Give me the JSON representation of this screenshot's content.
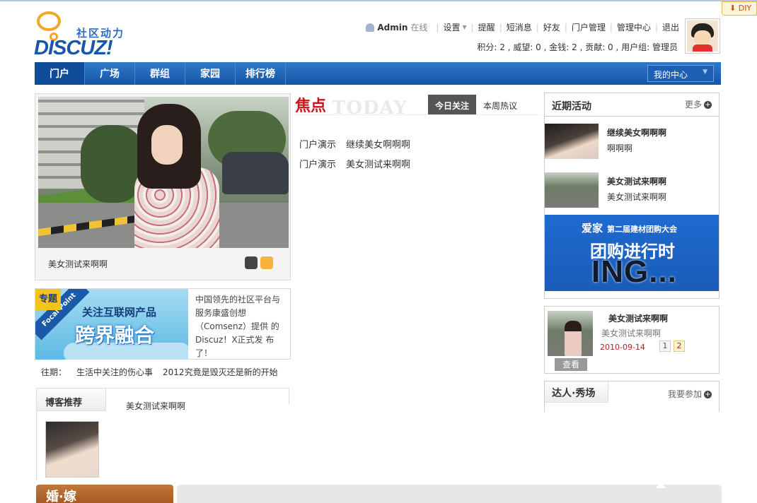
{
  "diy": {
    "label": "DIY"
  },
  "logo": {
    "slogan": "社区动力",
    "word": "DISCUZ!"
  },
  "user": {
    "name": "Admin",
    "status": "在线",
    "links": [
      "设置",
      "提醒",
      "短消息",
      "好友",
      "门户管理",
      "管理中心",
      "退出"
    ]
  },
  "credits": {
    "text": "积分: 2 , 威望: 0 , 金钱: 2 , 贡献: 0 , 用户组: 管理员"
  },
  "nav": {
    "items": [
      "门户",
      "广场",
      "群组",
      "家园",
      "排行榜"
    ],
    "my_center": "我的中心"
  },
  "slide": {
    "caption": "美女测试来啊啊"
  },
  "topic": {
    "tag": "专题",
    "ribbon": "Focal Point",
    "title_small": "关注互联网产品",
    "title_big": "跨界融合",
    "description": "中国领先的社区平台与服务康盛创想（Comsenz）提供 的Discuz！X正式发 布了！"
  },
  "past": {
    "label": "往期：",
    "items": [
      "生活中关注的伤心事",
      "2012究竟是毁灭还是新的开始"
    ]
  },
  "blog": {
    "title": "博客推荐",
    "text": "美女测试来啊啊"
  },
  "hunlian": {
    "title": "婚·嫁"
  },
  "focus": {
    "title": "焦点",
    "watermark": "TODAY",
    "tabs": [
      "今日关注",
      "本周热议"
    ],
    "items": [
      {
        "category": "门户演示",
        "title": "继续美女啊啊啊"
      },
      {
        "category": "门户演示",
        "title": "美女测试来啊啊"
      }
    ]
  },
  "activity": {
    "title": "近期活动",
    "more": "更多",
    "items": [
      {
        "title": "继续美女啊啊啊",
        "desc": "啊啊啊"
      },
      {
        "title": "美女测试来啊啊",
        "desc": "美女测试来啊啊"
      }
    ],
    "ad": {
      "brand": "爱家",
      "event": "第二届建材团购大会",
      "headline": "团购进行时",
      "big": "ING..."
    }
  },
  "topstat": {
    "title": "美女测试来啊啊",
    "subtitle": "美女测试来啊啊",
    "date": "2010-09-14",
    "view": "查看",
    "pages": [
      "1",
      "2"
    ]
  },
  "talent": {
    "title": "达人·秀场",
    "join": "我要参加"
  }
}
